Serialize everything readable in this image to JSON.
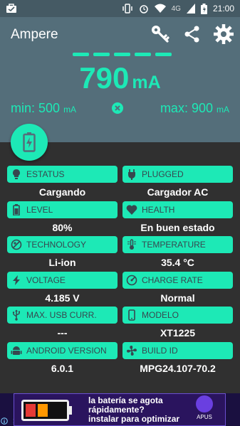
{
  "status_bar": {
    "time": "21:00",
    "network": "4G",
    "icons": [
      "briefcase-icon",
      "vibrate-icon",
      "alarm-icon",
      "wifi-icon",
      "signal-icon",
      "battery-icon"
    ]
  },
  "app": {
    "title": "Ampere",
    "actions": [
      "key-icon",
      "share-icon",
      "settings-icon"
    ]
  },
  "reading": {
    "current_value": "790",
    "current_unit": "mA",
    "min_label": "min: 500",
    "min_unit": "mA",
    "max_label": "max: 900",
    "max_unit": "mA",
    "dash_count": 5
  },
  "colors": {
    "accent": "#1DE9B6",
    "appbar": "#546E7A",
    "statusbar": "#455A64",
    "background": "#303030",
    "label_text": "#37474F"
  },
  "cards": [
    {
      "label": "ESTATUS",
      "value": "Cargando",
      "icon": "lightbulb-icon"
    },
    {
      "label": "PLUGGED",
      "value": "Cargador AC",
      "icon": "plug-icon"
    },
    {
      "label": "LEVEL",
      "value": "80%",
      "icon": "battery-level-icon"
    },
    {
      "label": "HEALTH",
      "value": "En buen estado",
      "icon": "heart-icon"
    },
    {
      "label": "TECHNOLOGY",
      "value": "Li-ion",
      "icon": "technology-icon"
    },
    {
      "label": "TEMPERATURE",
      "value": "35.4 °C",
      "icon": "thermometer-icon"
    },
    {
      "label": "VOLTAGE",
      "value": "4.185 V",
      "icon": "bolt-icon"
    },
    {
      "label": "CHARGE RATE",
      "value": "Normal",
      "icon": "speedometer-icon"
    },
    {
      "label": "MAX. USB CURR.",
      "value": "---",
      "icon": "usb-icon"
    },
    {
      "label": "MODELO",
      "value": "XT1225",
      "icon": "phone-icon"
    },
    {
      "label": "ANDROID VERSION",
      "value": "6.0.1",
      "icon": "android-icon"
    },
    {
      "label": "BUILD ID",
      "value": "MPG24.107-70.2",
      "icon": "fan-icon"
    }
  ],
  "ad": {
    "line1": "la batería se agota",
    "line2": "rápidamente?",
    "line3": "instalar para optimizar",
    "brand": "APUS"
  }
}
